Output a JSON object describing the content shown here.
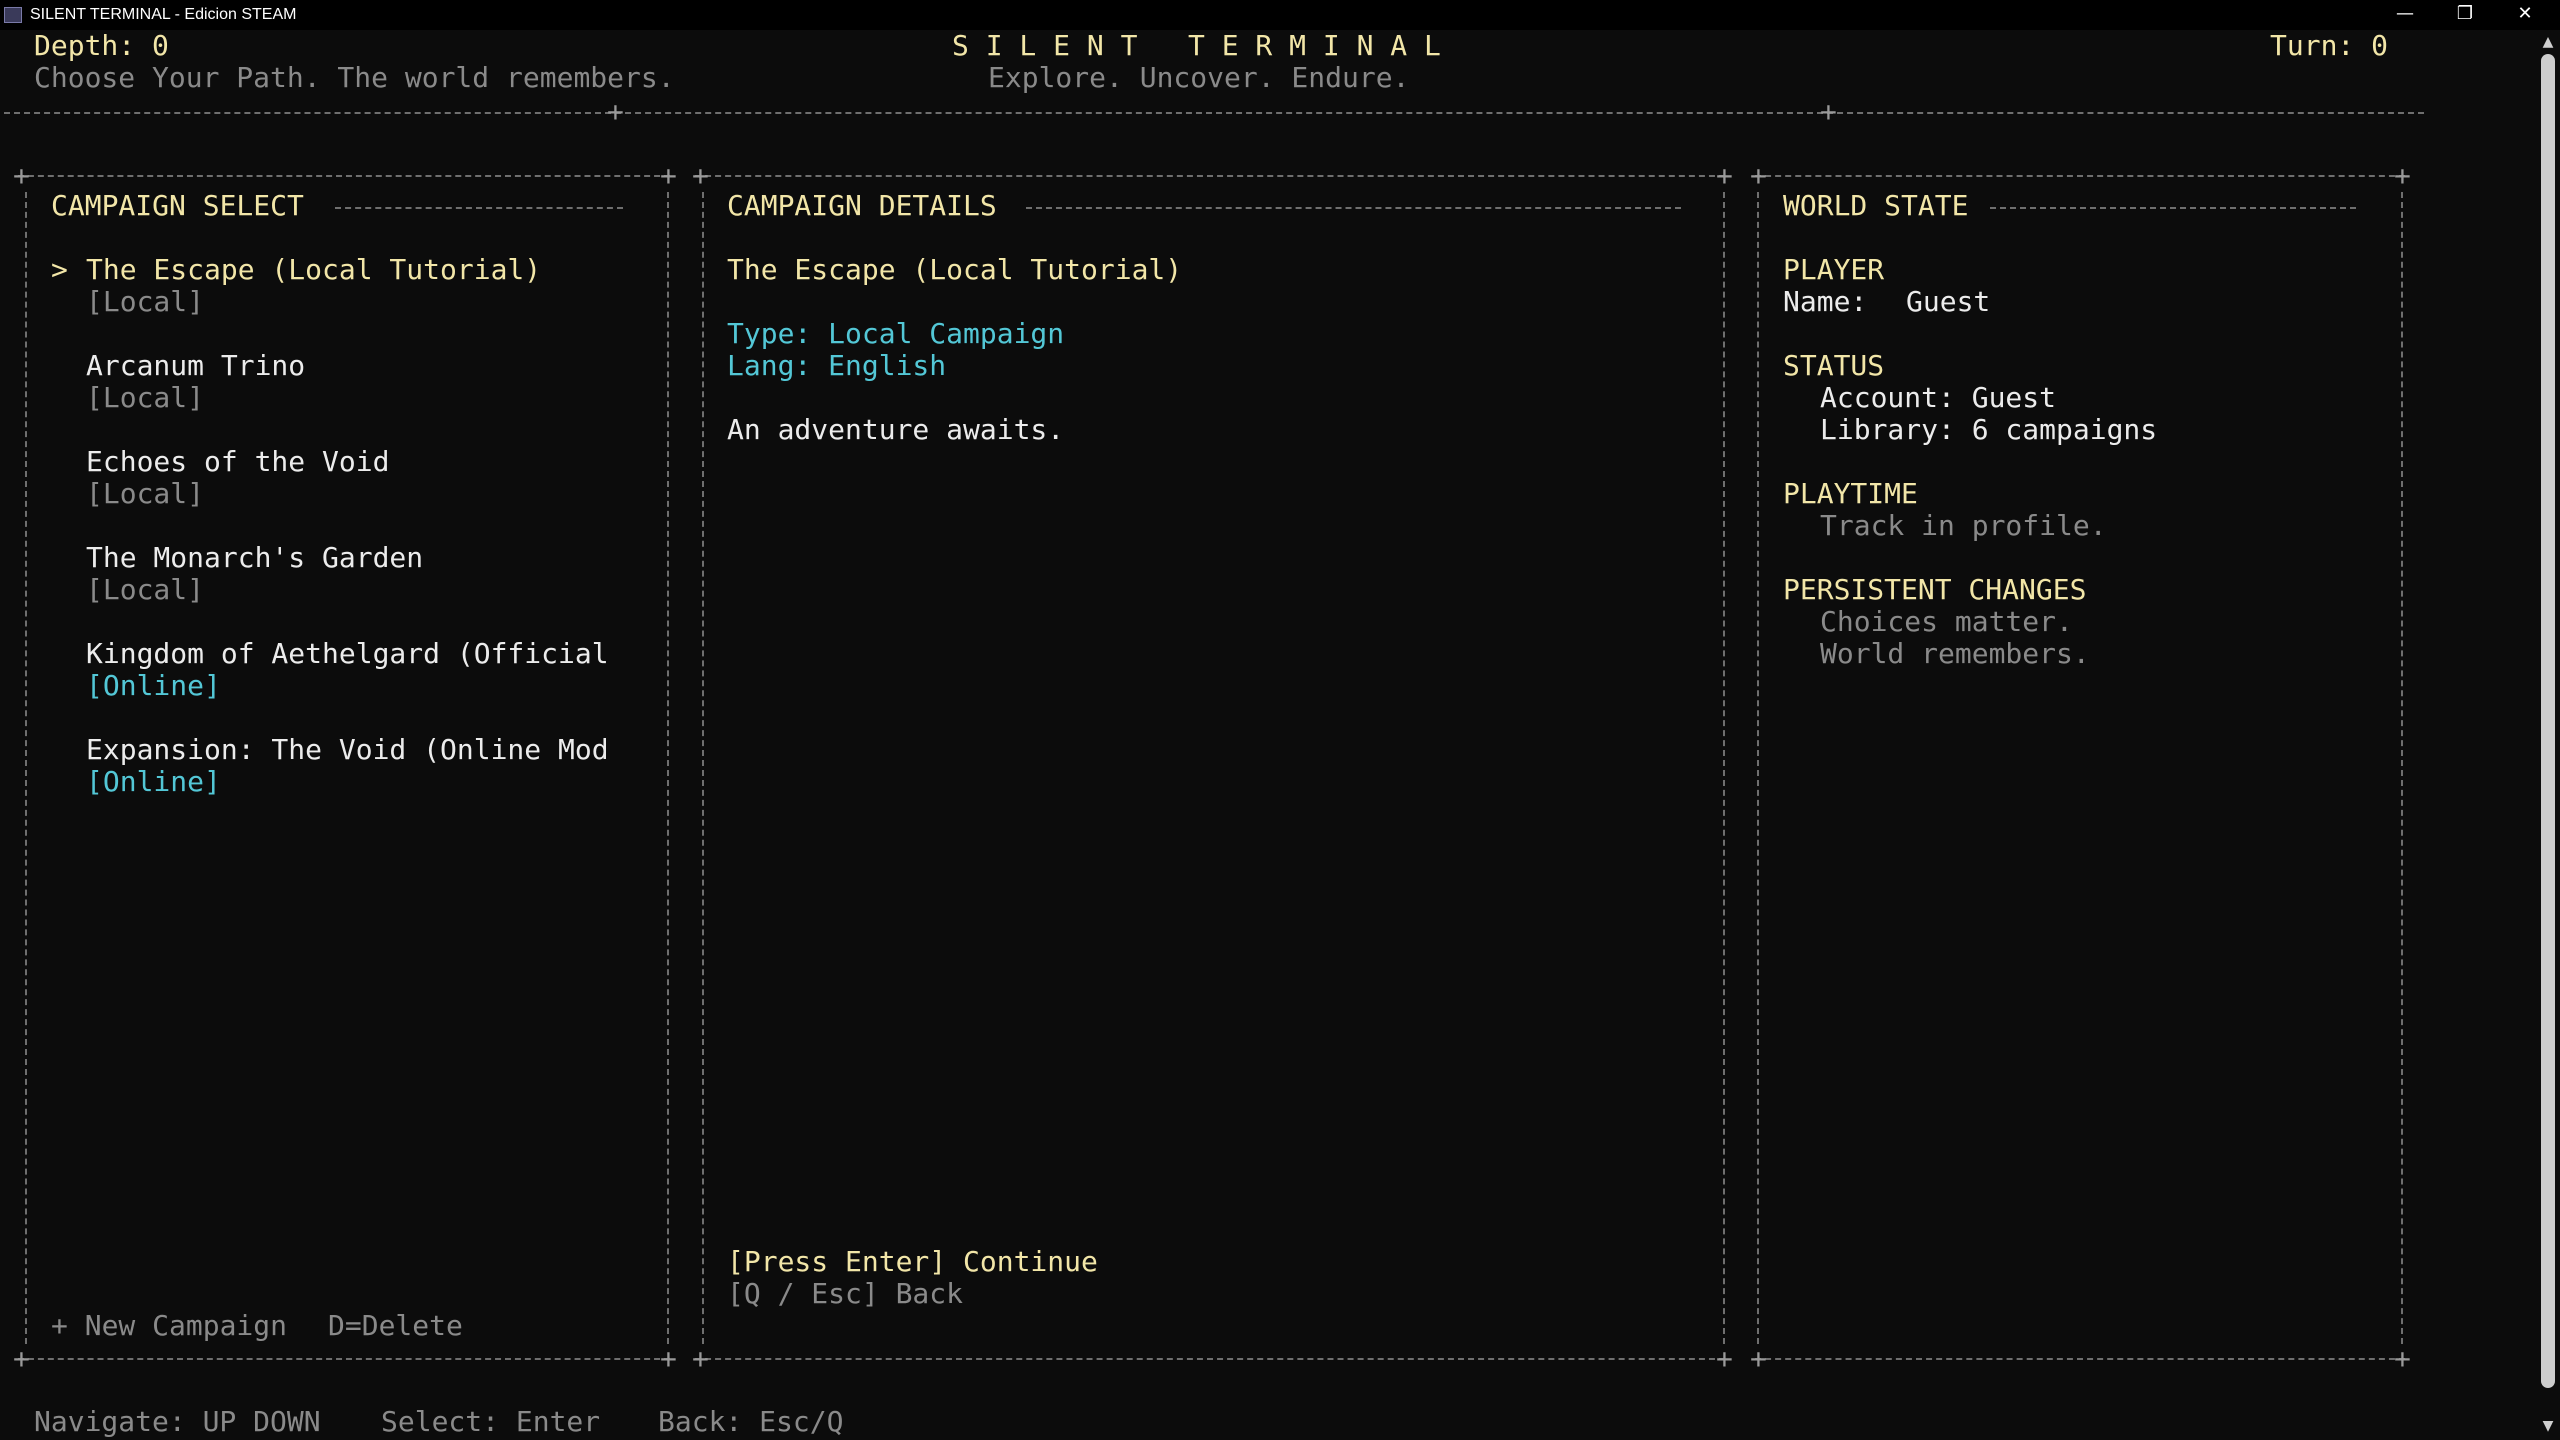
{
  "window": {
    "title": "SILENT TERMINAL - Edicion STEAM",
    "minimize": "—",
    "maximize": "❐",
    "close": "✕"
  },
  "header": {
    "depth": "Depth: 0",
    "tagline": "Choose Your Path. The world remembers.",
    "game_title": "S I L E N T   T E R M I N A L",
    "subtitle": "Explore. Uncover. Endure.",
    "turn": "Turn: 0"
  },
  "campaign_select": {
    "title": "CAMPAIGN SELECT",
    "selected_marker": ">",
    "items": [
      {
        "name": "The Escape (Local Tutorial)",
        "tag": "[Local]"
      },
      {
        "name": "Arcanum Trino",
        "tag": "[Local]"
      },
      {
        "name": "Echoes of the Void",
        "tag": "[Local]"
      },
      {
        "name": "The Monarch's Garden",
        "tag": "[Local]"
      },
      {
        "name": "Kingdom of Aethelgard (Official",
        "tag": "[Online]"
      },
      {
        "name": "Expansion: The Void (Online Mod",
        "tag": "[Online]"
      }
    ],
    "new_campaign": "+ New Campaign",
    "delete_hint": "D=Delete"
  },
  "campaign_details": {
    "title": "CAMPAIGN DETAILS",
    "name": "The Escape (Local Tutorial)",
    "type": "Type: Local Campaign",
    "lang": "Lang: English",
    "description": "An adventure awaits.",
    "continue": "[Press Enter] Continue",
    "back": "[Q / Esc] Back"
  },
  "world_state": {
    "title": "WORLD STATE",
    "player_heading": "PLAYER",
    "player_name_label": "Name:",
    "player_name": "Guest",
    "status_heading": "STATUS",
    "account": "Account: Guest",
    "library": "Library: 6 campaigns",
    "playtime_heading": "PLAYTIME",
    "playtime_text": "Track in profile.",
    "persistent_heading": "PERSISTENT CHANGES",
    "persistent_line1": "Choices matter.",
    "persistent_line2": "World remembers."
  },
  "footer": {
    "navigate": "Navigate: UP DOWN",
    "select": "Select: Enter",
    "back": "Back: Esc/Q"
  },
  "colors": {
    "background": "#0c0c0c",
    "heading": "#f2e6a8",
    "muted": "#8a8a8a",
    "online": "#53c7d6",
    "border": "#6f6f6f"
  }
}
